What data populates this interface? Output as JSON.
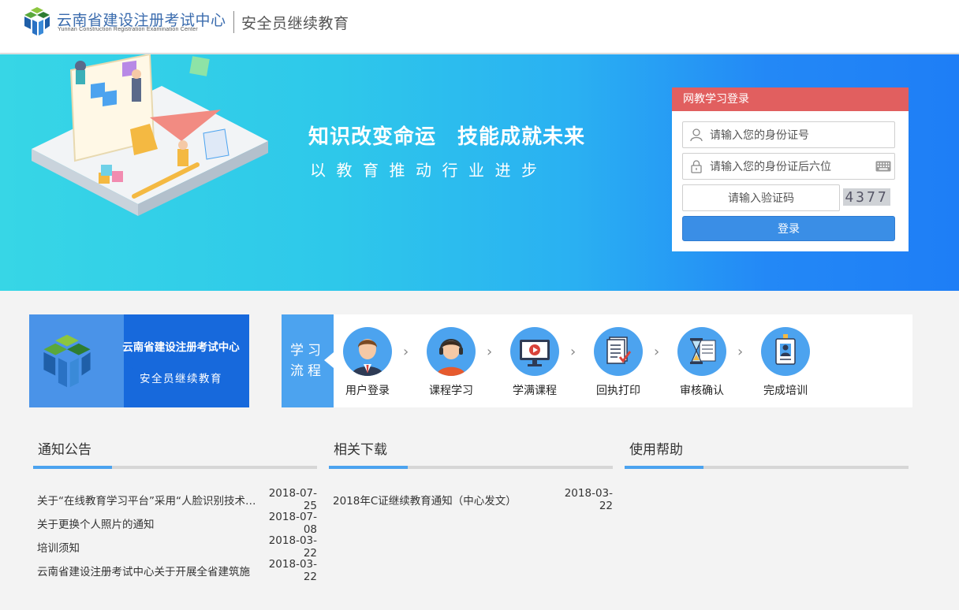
{
  "header": {
    "org_name": "云南省建设注册考试中心",
    "org_name_en": "Yunnan Construction Registration Examination Center",
    "subtitle": "安全员继续教育"
  },
  "banner": {
    "slogan_main": "知识改变命运　技能成就未来",
    "slogan_sub": "以教育推动行业进步"
  },
  "login": {
    "title": "网教学习登录",
    "id_placeholder": "请输入您的身份证号",
    "pwd_placeholder": "请输入您的身份证后六位",
    "captcha_placeholder": "请输入验证码",
    "captcha_code": "4377",
    "submit_label": "登录"
  },
  "center_card": {
    "title": "云南省建设注册考试中心",
    "subtitle": "安全员继续教育"
  },
  "process": {
    "label_line1": "学习",
    "label_line2": "流程",
    "steps": [
      {
        "label": "用户登录",
        "icon": "user-icon"
      },
      {
        "label": "课程学习",
        "icon": "headset-icon"
      },
      {
        "label": "学满课程",
        "icon": "monitor-play-icon"
      },
      {
        "label": "回执打印",
        "icon": "document-check-icon"
      },
      {
        "label": "审核确认",
        "icon": "hourglass-icon"
      },
      {
        "label": "完成培训",
        "icon": "id-badge-icon"
      }
    ]
  },
  "notices": {
    "title": "通知公告",
    "items": [
      {
        "title": "关于“在线教育学习平台”采用“人脸识别技术”的通知",
        "date": "2018-07-25"
      },
      {
        "title": "关于更换个人照片的通知",
        "date": "2018-07-08"
      },
      {
        "title": "培训须知",
        "date": "2018-03-22"
      },
      {
        "title": "云南省建设注册考试中心关于开展全省建筑施",
        "date": "2018-03-22"
      }
    ]
  },
  "downloads": {
    "title": "相关下载",
    "items": [
      {
        "title": "2018年C证继续教育通知（中心发文）",
        "date": "2018-03-22"
      }
    ]
  },
  "help": {
    "title": "使用帮助"
  },
  "colors": {
    "brand_blue": "#3b6cae",
    "login_header": "#e15f5f",
    "button_blue": "#3a8ee6",
    "accent_blue": "#4ca3ef"
  }
}
